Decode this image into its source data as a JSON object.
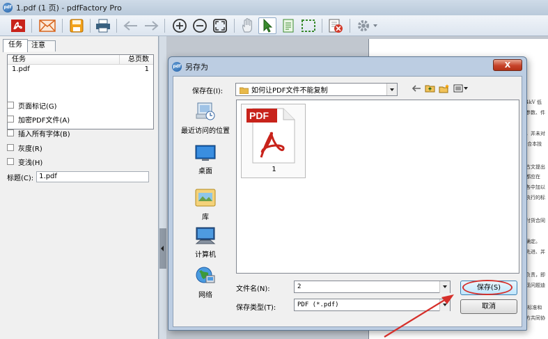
{
  "app": {
    "title": "1.pdf (1 页) - pdfFactory Pro",
    "logo_text": "pdf"
  },
  "toolbar": {
    "icons": [
      "acrobat-icon",
      "email-icon",
      "save-icon",
      "print-icon",
      "back-arrow-icon",
      "forward-arrow-icon",
      "zoom-in-icon",
      "zoom-out-icon",
      "fit-page-icon",
      "hand-tool-icon",
      "select-arrow-icon",
      "text-select-icon",
      "marquee-select-icon",
      "delete-page-icon",
      "settings-gear-icon"
    ]
  },
  "left_panel": {
    "tabs": [
      "任务",
      "注意"
    ],
    "task_table": {
      "columns": [
        "任务",
        "总页数"
      ],
      "rows": [
        {
          "name": "1.pdf",
          "pages": "1"
        }
      ]
    },
    "options": [
      "页面标记(G)",
      "加密PDF文件(A)",
      "插入所有字体(B)",
      "灰度(R)",
      "变浅(H)"
    ],
    "title_label": "标题(C):",
    "title_value": "1.pdf"
  },
  "preview": {
    "lines": [
      "4kV 低",
      "参数、件",
      "，并未对",
      "·合本技",
      "古文提出",
      "都应在",
      "各中加以",
      "执行的标",
      "付货合同",
      "确定。",
      "先进、并",
      "负责，即",
      "现问题迪",
      "·标准和",
      "方共同协"
    ]
  },
  "dialog": {
    "title": "另存为",
    "logo_text": "pdf",
    "close_label": "X",
    "save_in_label": "保存在(I):",
    "save_in_value": "如何让PDF文件不能复制",
    "places": [
      {
        "label": "最近访问的位置",
        "icon": "recent-places-icon"
      },
      {
        "label": "桌面",
        "icon": "desktop-icon"
      },
      {
        "label": "库",
        "icon": "libraries-icon"
      },
      {
        "label": "计算机",
        "icon": "computer-icon"
      },
      {
        "label": "网络",
        "icon": "network-icon"
      }
    ],
    "files": [
      {
        "name": "1",
        "type_badge": "PDF"
      }
    ],
    "filename_label": "文件名(N):",
    "filename_value": "2",
    "filetype_label": "保存类型(T):",
    "filetype_value": "PDF (*.pdf)",
    "save_button": "保存(S)",
    "cancel_button": "取消"
  },
  "colors": {
    "highlight": "#d62f2a",
    "acrobat_red": "#c8231b",
    "selection_green": "#3a8a2e"
  }
}
